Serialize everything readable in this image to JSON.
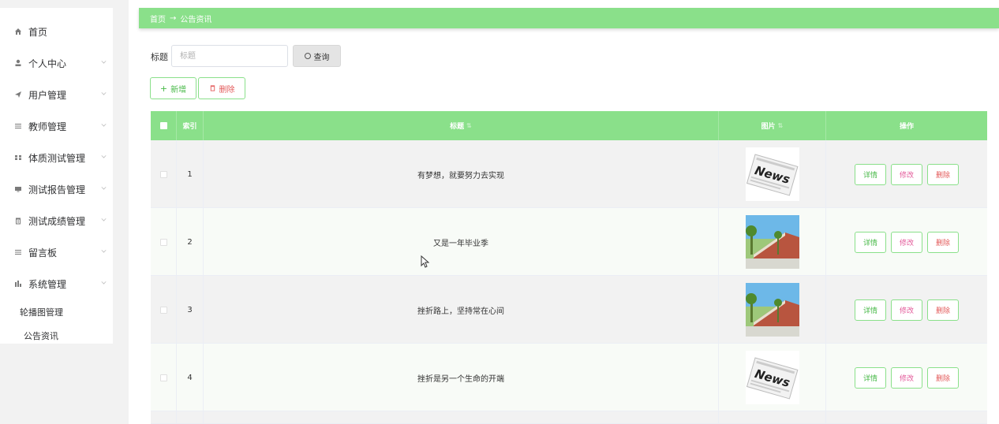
{
  "sidebar": {
    "items": [
      {
        "label": "首页",
        "icon": "home-icon",
        "expandable": false
      },
      {
        "label": "个人中心",
        "icon": "user-icon",
        "expandable": true
      },
      {
        "label": "用户管理",
        "icon": "send-icon",
        "expandable": true
      },
      {
        "label": "教师管理",
        "icon": "list-icon",
        "expandable": true
      },
      {
        "label": "体质测试管理",
        "icon": "grid-icon",
        "expandable": true
      },
      {
        "label": "测试报告管理",
        "icon": "monitor-icon",
        "expandable": true
      },
      {
        "label": "测试成绩管理",
        "icon": "trash-icon",
        "expandable": true
      },
      {
        "label": "留言板",
        "icon": "list-icon",
        "expandable": true
      },
      {
        "label": "系统管理",
        "icon": "chart-icon",
        "expandable": true
      }
    ],
    "sub_items": [
      {
        "label": "轮播图管理"
      },
      {
        "label": "公告资讯"
      }
    ]
  },
  "breadcrumb": {
    "home": "首页",
    "separator": "→",
    "current": "公告资讯"
  },
  "search": {
    "label": "标题",
    "placeholder": "标题",
    "value": "",
    "button": "查询"
  },
  "actions": {
    "add": "新增",
    "delete": "删除"
  },
  "table": {
    "headers": {
      "index": "索引",
      "title": "标题",
      "image": "图片",
      "ops": "操作"
    },
    "rows": [
      {
        "index": "1",
        "title": "有梦想，就要努力去实现",
        "image": "news"
      },
      {
        "index": "2",
        "title": "又是一年毕业季",
        "image": "campus"
      },
      {
        "index": "3",
        "title": "挫折路上，坚持常在心间",
        "image": "campus"
      },
      {
        "index": "4",
        "title": "挫折是另一个生命的开端",
        "image": "news"
      }
    ],
    "op_labels": {
      "detail": "详情",
      "edit": "修改",
      "delete": "删除"
    },
    "news_text": "News"
  },
  "colors": {
    "accent": "#8ae08a",
    "danger": "#e35a5a"
  }
}
